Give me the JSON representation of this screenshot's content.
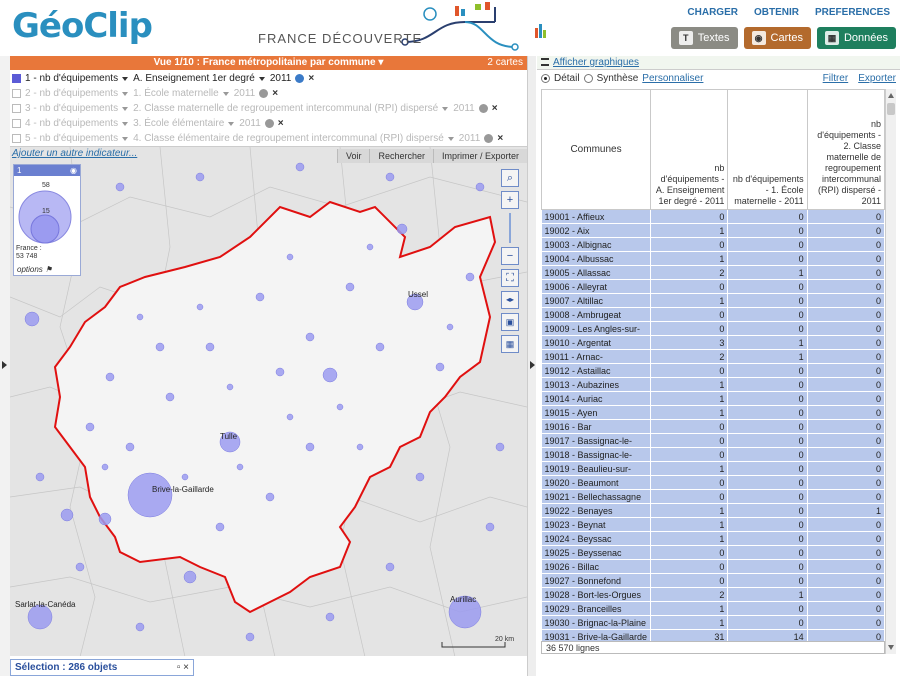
{
  "app": {
    "logo": "GéoClip",
    "tagline": "FRANCE DÉCOUVERTE"
  },
  "topmenu": [
    "CHARGER",
    "OBTENIR",
    "PREFERENCES"
  ],
  "tabs": [
    {
      "label": "Textes",
      "icon": "text-icon"
    },
    {
      "label": "Cartes",
      "icon": "map-icon"
    },
    {
      "label": "Données",
      "icon": "data-icon"
    }
  ],
  "view": {
    "title": "Vue 1/10 : France métropolitaine par commune",
    "count": "2 cartes"
  },
  "indicators": [
    {
      "label": "1 - nb d'équipements",
      "sub": "A. Enseignement 1er degré",
      "year": "2011",
      "active": true
    },
    {
      "label": "2 - nb d'équipements",
      "sub": "1. École maternelle",
      "year": "2011",
      "active": false
    },
    {
      "label": "3 - nb d'équipements",
      "sub": "2. Classe maternelle de regroupement intercommunal (RPI) dispersé",
      "year": "2011",
      "active": false
    },
    {
      "label": "4 - nb d'équipements",
      "sub": "3. École élémentaire",
      "year": "2011",
      "active": false
    },
    {
      "label": "5 - nb d'équipements",
      "sub": "4. Classe élémentaire de regroupement intercommunal (RPI) dispersé",
      "year": "2011",
      "active": false
    }
  ],
  "map": {
    "add_indicator": "Ajouter un autre indicateur...",
    "tools": [
      "Voir",
      "Rechercher",
      "Imprimer / Exporter"
    ],
    "legend": {
      "head": "1",
      "v1": "58",
      "v2": "15",
      "france_label": "France :",
      "france_value": "53 748",
      "options": "options"
    },
    "cities": [
      "Ussel",
      "Tulle",
      "Brive-la-Gaillarde",
      "Sarlat-la-Canéda",
      "Aurillac"
    ],
    "scale": "20 km"
  },
  "selection": {
    "label": "Sélection : 286 objets"
  },
  "right": {
    "graph_link": "Afficher graphiques",
    "mode_detail": "Détail",
    "mode_synthese": "Synthèse",
    "customize": "Personnaliser",
    "filter": "Filtrer",
    "export": "Exporter",
    "headers": [
      "Communes",
      "nb d'équipements - A. Enseignement 1er degré - 2011",
      "nb d'équipements - 1. École maternelle - 2011",
      "nb d'équipements - 2. Classe maternelle de regroupement intercommunal (RPI) dispersé - 2011"
    ],
    "rows": [
      [
        "19001 - Affieux",
        "0",
        "0",
        "0"
      ],
      [
        "19002 - Aix",
        "1",
        "0",
        "0"
      ],
      [
        "19003 - Albignac",
        "0",
        "0",
        "0"
      ],
      [
        "19004 - Albussac",
        "1",
        "0",
        "0"
      ],
      [
        "19005 - Allassac",
        "2",
        "1",
        "0"
      ],
      [
        "19006 - Alleyrat",
        "0",
        "0",
        "0"
      ],
      [
        "19007 - Altillac",
        "1",
        "0",
        "0"
      ],
      [
        "19008 - Ambrugeat",
        "0",
        "0",
        "0"
      ],
      [
        "19009 - Les Angles-sur-",
        "0",
        "0",
        "0"
      ],
      [
        "19010 - Argentat",
        "3",
        "1",
        "0"
      ],
      [
        "19011 - Arnac-",
        "2",
        "1",
        "0"
      ],
      [
        "19012 - Astaillac",
        "0",
        "0",
        "0"
      ],
      [
        "19013 - Aubazines",
        "1",
        "0",
        "0"
      ],
      [
        "19014 - Auriac",
        "1",
        "0",
        "0"
      ],
      [
        "19015 - Ayen",
        "1",
        "0",
        "0"
      ],
      [
        "19016 - Bar",
        "0",
        "0",
        "0"
      ],
      [
        "19017 - Bassignac-le-",
        "0",
        "0",
        "0"
      ],
      [
        "19018 - Bassignac-le-",
        "0",
        "0",
        "0"
      ],
      [
        "19019 - Beaulieu-sur-",
        "1",
        "0",
        "0"
      ],
      [
        "19020 - Beaumont",
        "0",
        "0",
        "0"
      ],
      [
        "19021 - Bellechassagne",
        "0",
        "0",
        "0"
      ],
      [
        "19022 - Benayes",
        "1",
        "0",
        "1"
      ],
      [
        "19023 - Beynat",
        "1",
        "0",
        "0"
      ],
      [
        "19024 - Beyssac",
        "1",
        "0",
        "0"
      ],
      [
        "19025 - Beyssenac",
        "0",
        "0",
        "0"
      ],
      [
        "19026 - Billac",
        "0",
        "0",
        "0"
      ],
      [
        "19027 - Bonnefond",
        "0",
        "0",
        "0"
      ],
      [
        "19028 - Bort-les-Orgues",
        "2",
        "1",
        "0"
      ],
      [
        "19029 - Branceilles",
        "1",
        "0",
        "0"
      ],
      [
        "19030 - Brignac-la-Plaine",
        "1",
        "0",
        "0"
      ],
      [
        "19031 - Brive-la-Gaillarde",
        "31",
        "14",
        "0"
      ]
    ],
    "footer": "36 570 lignes"
  }
}
